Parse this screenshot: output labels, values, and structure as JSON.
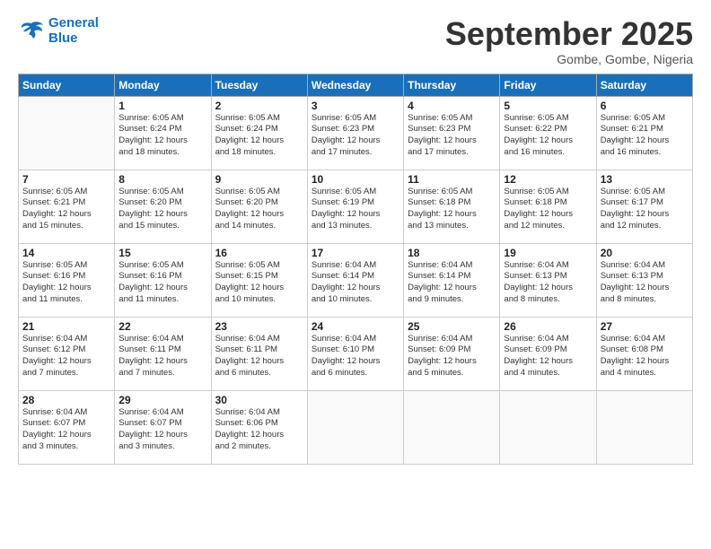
{
  "logo": {
    "line1": "General",
    "line2": "Blue"
  },
  "title": "September 2025",
  "subtitle": "Gombe, Gombe, Nigeria",
  "weekdays": [
    "Sunday",
    "Monday",
    "Tuesday",
    "Wednesday",
    "Thursday",
    "Friday",
    "Saturday"
  ],
  "weeks": [
    [
      {
        "day": "",
        "info": ""
      },
      {
        "day": "1",
        "info": "Sunrise: 6:05 AM\nSunset: 6:24 PM\nDaylight: 12 hours\nand 18 minutes."
      },
      {
        "day": "2",
        "info": "Sunrise: 6:05 AM\nSunset: 6:24 PM\nDaylight: 12 hours\nand 18 minutes."
      },
      {
        "day": "3",
        "info": "Sunrise: 6:05 AM\nSunset: 6:23 PM\nDaylight: 12 hours\nand 17 minutes."
      },
      {
        "day": "4",
        "info": "Sunrise: 6:05 AM\nSunset: 6:23 PM\nDaylight: 12 hours\nand 17 minutes."
      },
      {
        "day": "5",
        "info": "Sunrise: 6:05 AM\nSunset: 6:22 PM\nDaylight: 12 hours\nand 16 minutes."
      },
      {
        "day": "6",
        "info": "Sunrise: 6:05 AM\nSunset: 6:21 PM\nDaylight: 12 hours\nand 16 minutes."
      }
    ],
    [
      {
        "day": "7",
        "info": "Sunrise: 6:05 AM\nSunset: 6:21 PM\nDaylight: 12 hours\nand 15 minutes."
      },
      {
        "day": "8",
        "info": "Sunrise: 6:05 AM\nSunset: 6:20 PM\nDaylight: 12 hours\nand 15 minutes."
      },
      {
        "day": "9",
        "info": "Sunrise: 6:05 AM\nSunset: 6:20 PM\nDaylight: 12 hours\nand 14 minutes."
      },
      {
        "day": "10",
        "info": "Sunrise: 6:05 AM\nSunset: 6:19 PM\nDaylight: 12 hours\nand 13 minutes."
      },
      {
        "day": "11",
        "info": "Sunrise: 6:05 AM\nSunset: 6:18 PM\nDaylight: 12 hours\nand 13 minutes."
      },
      {
        "day": "12",
        "info": "Sunrise: 6:05 AM\nSunset: 6:18 PM\nDaylight: 12 hours\nand 12 minutes."
      },
      {
        "day": "13",
        "info": "Sunrise: 6:05 AM\nSunset: 6:17 PM\nDaylight: 12 hours\nand 12 minutes."
      }
    ],
    [
      {
        "day": "14",
        "info": "Sunrise: 6:05 AM\nSunset: 6:16 PM\nDaylight: 12 hours\nand 11 minutes."
      },
      {
        "day": "15",
        "info": "Sunrise: 6:05 AM\nSunset: 6:16 PM\nDaylight: 12 hours\nand 11 minutes."
      },
      {
        "day": "16",
        "info": "Sunrise: 6:05 AM\nSunset: 6:15 PM\nDaylight: 12 hours\nand 10 minutes."
      },
      {
        "day": "17",
        "info": "Sunrise: 6:04 AM\nSunset: 6:14 PM\nDaylight: 12 hours\nand 10 minutes."
      },
      {
        "day": "18",
        "info": "Sunrise: 6:04 AM\nSunset: 6:14 PM\nDaylight: 12 hours\nand 9 minutes."
      },
      {
        "day": "19",
        "info": "Sunrise: 6:04 AM\nSunset: 6:13 PM\nDaylight: 12 hours\nand 8 minutes."
      },
      {
        "day": "20",
        "info": "Sunrise: 6:04 AM\nSunset: 6:13 PM\nDaylight: 12 hours\nand 8 minutes."
      }
    ],
    [
      {
        "day": "21",
        "info": "Sunrise: 6:04 AM\nSunset: 6:12 PM\nDaylight: 12 hours\nand 7 minutes."
      },
      {
        "day": "22",
        "info": "Sunrise: 6:04 AM\nSunset: 6:11 PM\nDaylight: 12 hours\nand 7 minutes."
      },
      {
        "day": "23",
        "info": "Sunrise: 6:04 AM\nSunset: 6:11 PM\nDaylight: 12 hours\nand 6 minutes."
      },
      {
        "day": "24",
        "info": "Sunrise: 6:04 AM\nSunset: 6:10 PM\nDaylight: 12 hours\nand 6 minutes."
      },
      {
        "day": "25",
        "info": "Sunrise: 6:04 AM\nSunset: 6:09 PM\nDaylight: 12 hours\nand 5 minutes."
      },
      {
        "day": "26",
        "info": "Sunrise: 6:04 AM\nSunset: 6:09 PM\nDaylight: 12 hours\nand 4 minutes."
      },
      {
        "day": "27",
        "info": "Sunrise: 6:04 AM\nSunset: 6:08 PM\nDaylight: 12 hours\nand 4 minutes."
      }
    ],
    [
      {
        "day": "28",
        "info": "Sunrise: 6:04 AM\nSunset: 6:07 PM\nDaylight: 12 hours\nand 3 minutes."
      },
      {
        "day": "29",
        "info": "Sunrise: 6:04 AM\nSunset: 6:07 PM\nDaylight: 12 hours\nand 3 minutes."
      },
      {
        "day": "30",
        "info": "Sunrise: 6:04 AM\nSunset: 6:06 PM\nDaylight: 12 hours\nand 2 minutes."
      },
      {
        "day": "",
        "info": ""
      },
      {
        "day": "",
        "info": ""
      },
      {
        "day": "",
        "info": ""
      },
      {
        "day": "",
        "info": ""
      }
    ]
  ]
}
